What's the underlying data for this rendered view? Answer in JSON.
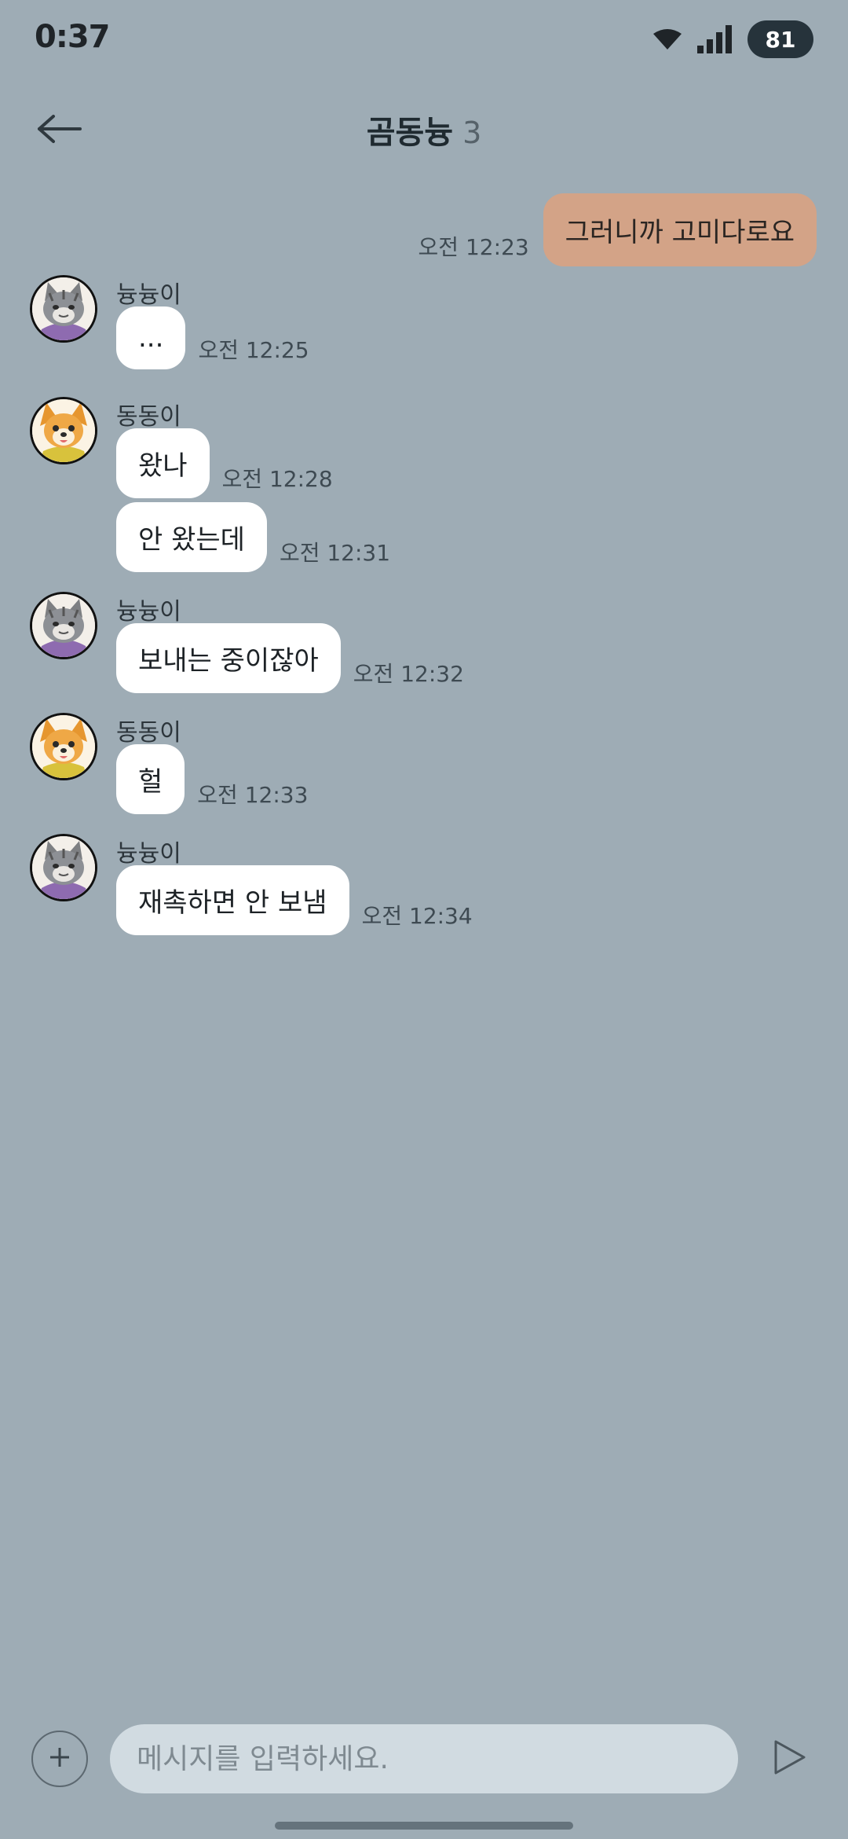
{
  "status_bar": {
    "time": "0:37",
    "battery": "81",
    "icons": [
      "wifi-icon",
      "signal-icon"
    ]
  },
  "header": {
    "back_icon": "arrow-left-icon",
    "title": "곰동늉",
    "member_count": "3"
  },
  "messages": [
    {
      "mine": true,
      "text": "그러니까 고미다로요",
      "time": "오전 12:23"
    },
    {
      "sender": "늉늉이",
      "avatar": "cat",
      "bubbles": [
        {
          "text": "...",
          "time": "오전 12:25"
        }
      ]
    },
    {
      "sender": "동동이",
      "avatar": "dog",
      "bubbles": [
        {
          "text": "왔나",
          "time": "오전 12:28"
        },
        {
          "text": "안 왔는데",
          "time": "오전 12:31"
        }
      ]
    },
    {
      "sender": "늉늉이",
      "avatar": "cat",
      "bubbles": [
        {
          "text": "보내는 중이잖아",
          "time": "오전 12:32"
        }
      ]
    },
    {
      "sender": "동동이",
      "avatar": "dog",
      "bubbles": [
        {
          "text": "헐",
          "time": "오전 12:33"
        }
      ]
    },
    {
      "sender": "늉늉이",
      "avatar": "cat",
      "bubbles": [
        {
          "text": "재촉하면 안 보냄",
          "time": "오전 12:34"
        }
      ]
    }
  ],
  "composer": {
    "placeholder": "메시지를 입력하세요.",
    "add_icon": "plus-icon",
    "send_icon": "send-icon"
  },
  "colors": {
    "background": "#9eacb5",
    "my_bubble": "#d3a387",
    "their_bubble": "#ffffff",
    "input_bg": "#d1dbe1"
  }
}
